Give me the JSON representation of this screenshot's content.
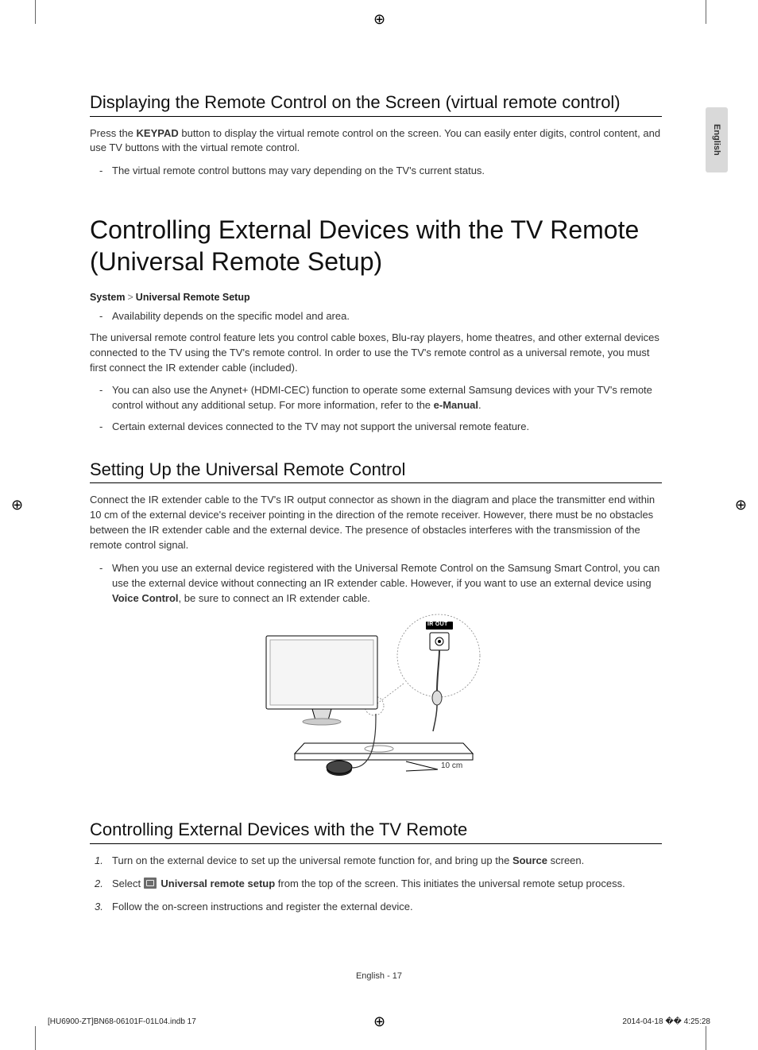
{
  "tab_label": "English",
  "section1": {
    "heading": "Displaying the Remote Control on the Screen (virtual remote control)",
    "p1_a": "Press the ",
    "p1_b": "KEYPAD",
    "p1_c": " button to display the virtual remote control on the screen. You can easily enter digits, control content, and use TV buttons with the virtual remote control.",
    "b1": "The virtual remote control buttons may vary depending on the TV's current status."
  },
  "section2": {
    "heading": "Controlling External Devices with the TV Remote (Universal Remote Setup)",
    "path_a": "System",
    "path_b": "Universal Remote Setup",
    "b1": "Availability depends on the specific model and area.",
    "p1": "The universal remote control feature lets you control cable boxes, Blu-ray players, home theatres, and other external devices connected to the TV using the TV's remote control. In order to use the TV's remote control as a universal remote, you must first connect the IR extender cable (included).",
    "b2_a": "You can also use the Anynet+ (HDMI-CEC) function to operate some external Samsung devices with your TV's remote control without any additional setup. For more information, refer to the ",
    "b2_b": "e-Manual",
    "b2_c": ".",
    "b3": "Certain external devices connected to the TV may not support the universal remote feature."
  },
  "section3": {
    "heading": "Setting Up the Universal Remote Control",
    "p1": "Connect the IR extender cable to the TV's IR output connector as shown in the diagram and place the transmitter end within 10 cm of the external device's receiver pointing in the direction of the remote receiver. However, there must be no obstacles between the IR extender cable and the external device. The presence of obstacles interferes with the transmission of the remote control signal.",
    "b1_a": "When you use an external device registered with the Universal Remote Control on the Samsung Smart Control, you can use the external device without connecting an IR extender cable. However, if you want to use an external device using ",
    "b1_b": "Voice Control",
    "b1_c": ", be sure to connect an IR extender cable.",
    "diagram": {
      "ir_out": "IR OUT",
      "dist": "10 cm"
    }
  },
  "section4": {
    "heading": "Controlling External Devices with the TV Remote",
    "step1_a": "Turn on the external device to set up the universal remote function for, and bring up the ",
    "step1_b": "Source",
    "step1_c": " screen.",
    "step2_a": "Select ",
    "step2_b": "Universal remote setup",
    "step2_c": " from the top of the screen. This initiates the universal remote setup process.",
    "step3": "Follow the on-screen instructions and register the external device."
  },
  "footer": {
    "center": "English - 17",
    "left": "[HU6900-ZT]BN68-06101F-01L04.indb   17",
    "right": "2014-04-18   �� 4:25:28"
  },
  "numbers": {
    "n1": "1.",
    "n2": "2.",
    "n3": "3."
  },
  "gt": ">"
}
